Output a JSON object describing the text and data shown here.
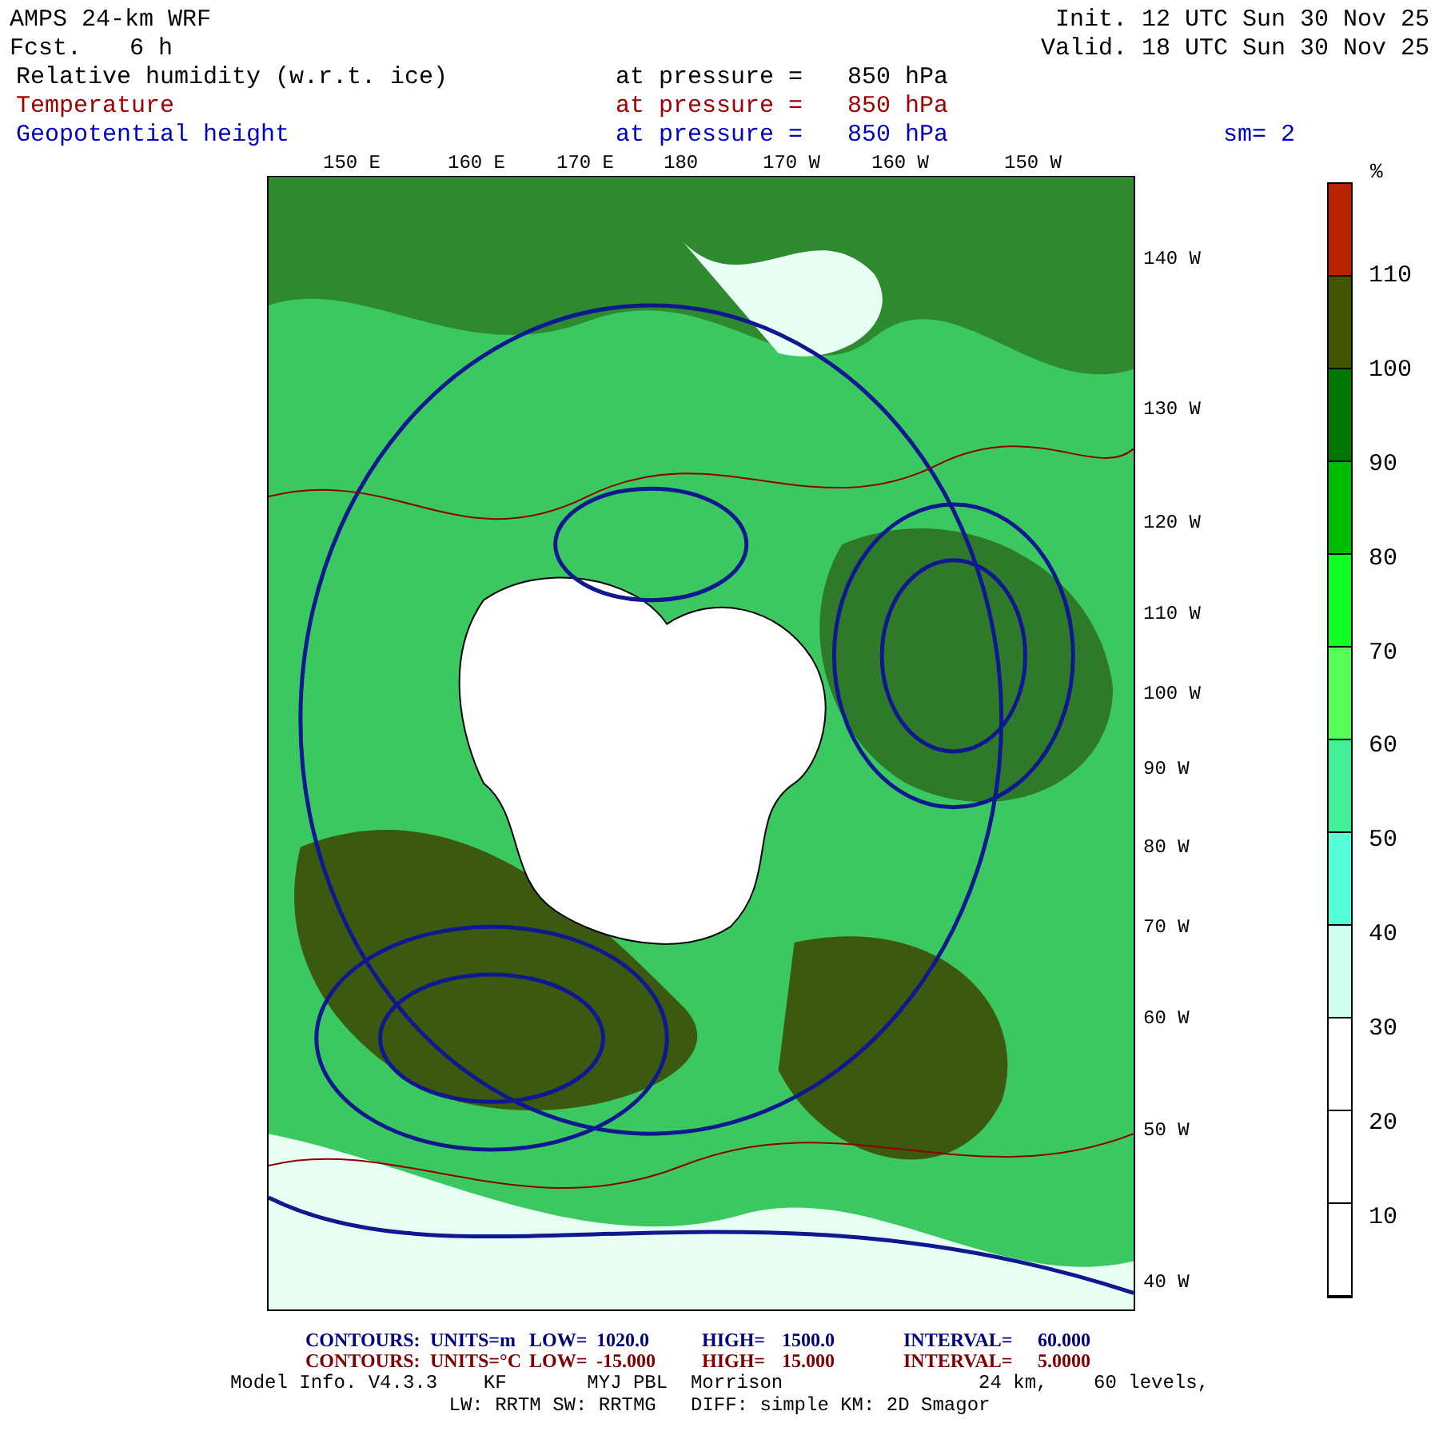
{
  "header": {
    "model": "AMPS 24-km WRF",
    "forecast_label": "Fcst.",
    "forecast": "6 h",
    "init": "Init. 12 UTC Sun 30 Nov 25",
    "valid": "Valid. 18 UTC Sun 30 Nov 25"
  },
  "fields": [
    {
      "name": "Relative humidity (w.r.t. ice)",
      "level_label": "at pressure =",
      "level": "850 hPa",
      "color": "#000000"
    },
    {
      "name": "Temperature",
      "level_label": "at pressure =",
      "level": "850 hPa",
      "color": "#a00000"
    },
    {
      "name": "Geopotential height",
      "level_label": "at pressure =",
      "level": "850 hPa",
      "color": "#0000c0"
    }
  ],
  "smoothing": "sm= 2",
  "top_longitudes": [
    "150 E",
    "160 E",
    "170 E",
    "180",
    "170 W",
    "160 W",
    "150 W"
  ],
  "right_longitudes": [
    "140 W",
    "130 W",
    "120 W",
    "110 W",
    "100 W",
    "90 W",
    "80 W",
    "70 W",
    "60 W",
    "50 W",
    "40 W"
  ],
  "colorbar": {
    "unit": "%",
    "bins": [
      {
        "color": "#bb2200"
      },
      {
        "color": "#445500"
      },
      {
        "color": "#007700"
      },
      {
        "color": "#00bb00"
      },
      {
        "color": "#11ff22"
      },
      {
        "color": "#55ff55"
      },
      {
        "color": "#44ee99"
      },
      {
        "color": "#55ffd8"
      },
      {
        "color": "#ccfff0"
      },
      {
        "color": "#ffffff"
      },
      {
        "color": "#ffffff"
      },
      {
        "color": "#ffffff"
      }
    ],
    "ticks": [
      "110",
      "100",
      "90",
      "80",
      "70",
      "60",
      "50",
      "40",
      "30",
      "20",
      "10"
    ]
  },
  "contours": [
    {
      "color": "#000080",
      "cells": [
        "CONTOURS:",
        "UNITS=m",
        "LOW=",
        "1020.0",
        "HIGH=",
        "1500.0",
        "INTERVAL=",
        "60.000"
      ]
    },
    {
      "color": "#800000",
      "cells": [
        "CONTOURS:",
        "UNITS=°C",
        "LOW=",
        "-15.000",
        "HIGH=",
        "15.000",
        "INTERVAL=",
        "5.0000"
      ]
    }
  ],
  "model_info": [
    "Model Info. V4.3.3    KF       MYJ PBL  Morrison                 24 km,    60 levels,",
    "LW: RRTM SW: RRTMG   DIFF: simple KM: 2D Smagor"
  ]
}
